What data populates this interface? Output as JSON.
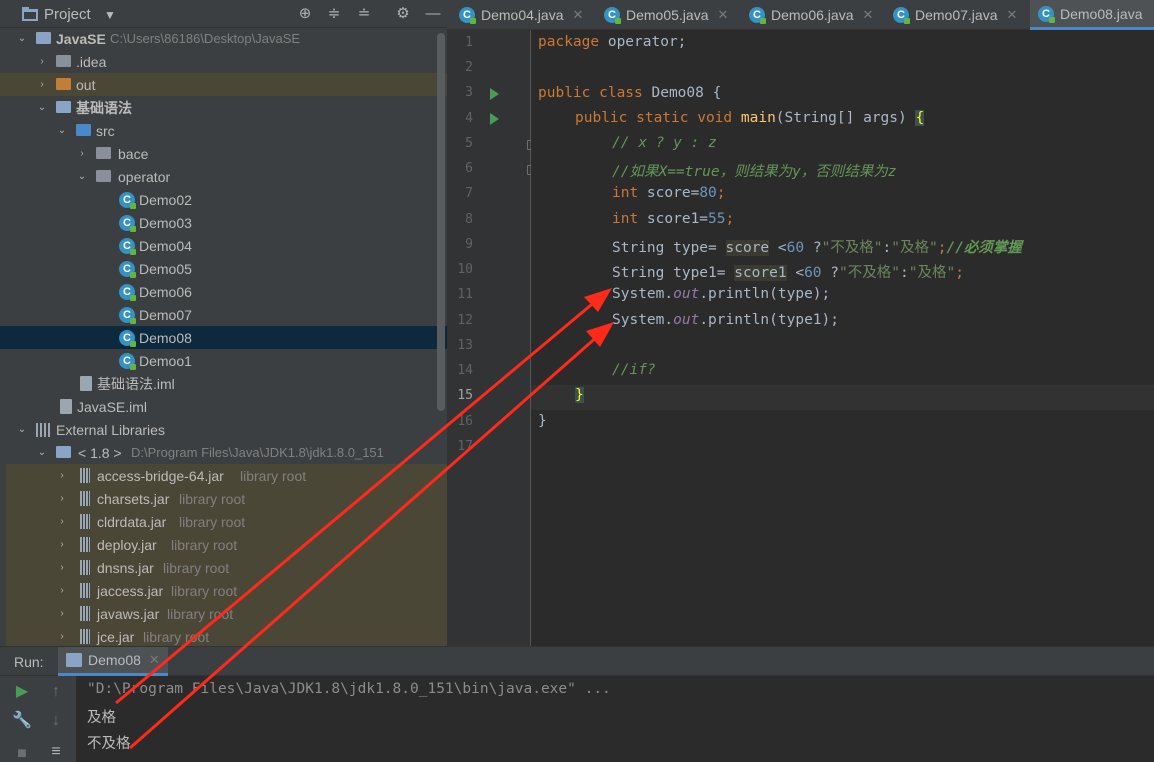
{
  "project_panel": {
    "title": "Project",
    "dropdown_icon": "chevron-down-icon",
    "tools": [
      "target-icon",
      "expand-all-icon",
      "collapse-all-icon",
      "gear-icon",
      "minimize-icon"
    ],
    "tree": {
      "root": {
        "label": "JavaSE",
        "path": "C:\\Users\\86186\\Desktop\\JavaSE"
      },
      "idea": ".idea",
      "out": "out",
      "module": "基础语法",
      "src": "src",
      "bace": "bace",
      "operator": "operator",
      "classes": [
        "Demo02",
        "Demo03",
        "Demo04",
        "Demo05",
        "Demo06",
        "Demo07",
        "Demo08",
        "Demoo1"
      ],
      "module_iml": "基础语法.iml",
      "project_iml": "JavaSE.iml",
      "external_libraries": "External Libraries",
      "jdk": {
        "label": "< 1.8 >",
        "path": "D:\\Program Files\\Java\\JDK1.8\\jdk1.8.0_151"
      },
      "jars": [
        {
          "name": "access-bridge-64.jar",
          "suffix": "library root"
        },
        {
          "name": "charsets.jar",
          "suffix": "library root"
        },
        {
          "name": "cldrdata.jar",
          "suffix": "library root"
        },
        {
          "name": "deploy.jar",
          "suffix": "library root"
        },
        {
          "name": "dnsns.jar",
          "suffix": "library root"
        },
        {
          "name": "jaccess.jar",
          "suffix": "library root"
        },
        {
          "name": "javaws.jar",
          "suffix": "library root"
        },
        {
          "name": "jce.jar",
          "suffix": "library root"
        }
      ]
    }
  },
  "editor_tabs": [
    "Demo04.java",
    "Demo05.java",
    "Demo06.java",
    "Demo07.java",
    "Demo08.java"
  ],
  "active_tab": "Demo08.java",
  "line_numbers": [
    "1",
    "2",
    "3",
    "4",
    "5",
    "6",
    "7",
    "8",
    "9",
    "10",
    "11",
    "12",
    "13",
    "14",
    "15",
    "16",
    "17"
  ],
  "code": {
    "l1": {
      "kw": "package",
      "rest": " operator;"
    },
    "l3": {
      "kw": "public class",
      "name": " Demo08 {"
    },
    "l4": {
      "kw": "public static void",
      "method": "main",
      "rest": "(String[] args) ",
      "brace": "{"
    },
    "l5": "// x ? y : z",
    "l6": "//如果X==true，则结果为y，否则结果为z",
    "l7": {
      "kw": "int",
      "rest": " score=",
      "num": "80",
      "end": ";"
    },
    "l8": {
      "kw": "int",
      "rest": " score1=",
      "num": "55",
      "end": ";"
    },
    "l9": {
      "a": "String type= ",
      "var": "score",
      "b": " <",
      "num": "60",
      "c": " ?",
      "s1": "\"不及格\"",
      "d": ":",
      "s2": "\"及格\"",
      "e": ";",
      "comment": "//必须掌握"
    },
    "l10": {
      "a": "String type1= ",
      "var": "score1",
      "b": " <",
      "num": "60",
      "c": " ?",
      "s1": "\"不及格\"",
      "d": ":",
      "s2": "\"及格\"",
      "e": ";"
    },
    "l11": {
      "a": "System.",
      "field": "out",
      "b": ".println(type);"
    },
    "l12": {
      "a": "System.",
      "field": "out",
      "b": ".println(type1);"
    },
    "l14": "//if?",
    "l15": "}",
    "l16": "}"
  },
  "run_panel": {
    "title": "Run:",
    "tab": "Demo08",
    "console": {
      "command": "\"D:\\Program Files\\Java\\JDK1.8\\jdk1.8.0_151\\bin\\java.exe\" ...",
      "output": [
        "及格",
        "不及格"
      ]
    },
    "tools": [
      "run-icon",
      "up-arrow-icon",
      "wrench-icon",
      "down-arrow-icon",
      "stop-icon",
      "soft-wrap-icon"
    ]
  },
  "colors": {
    "annotation_arrow": "#ff2a1a",
    "selection": "#0d293e",
    "accent": "#4a88c7"
  }
}
